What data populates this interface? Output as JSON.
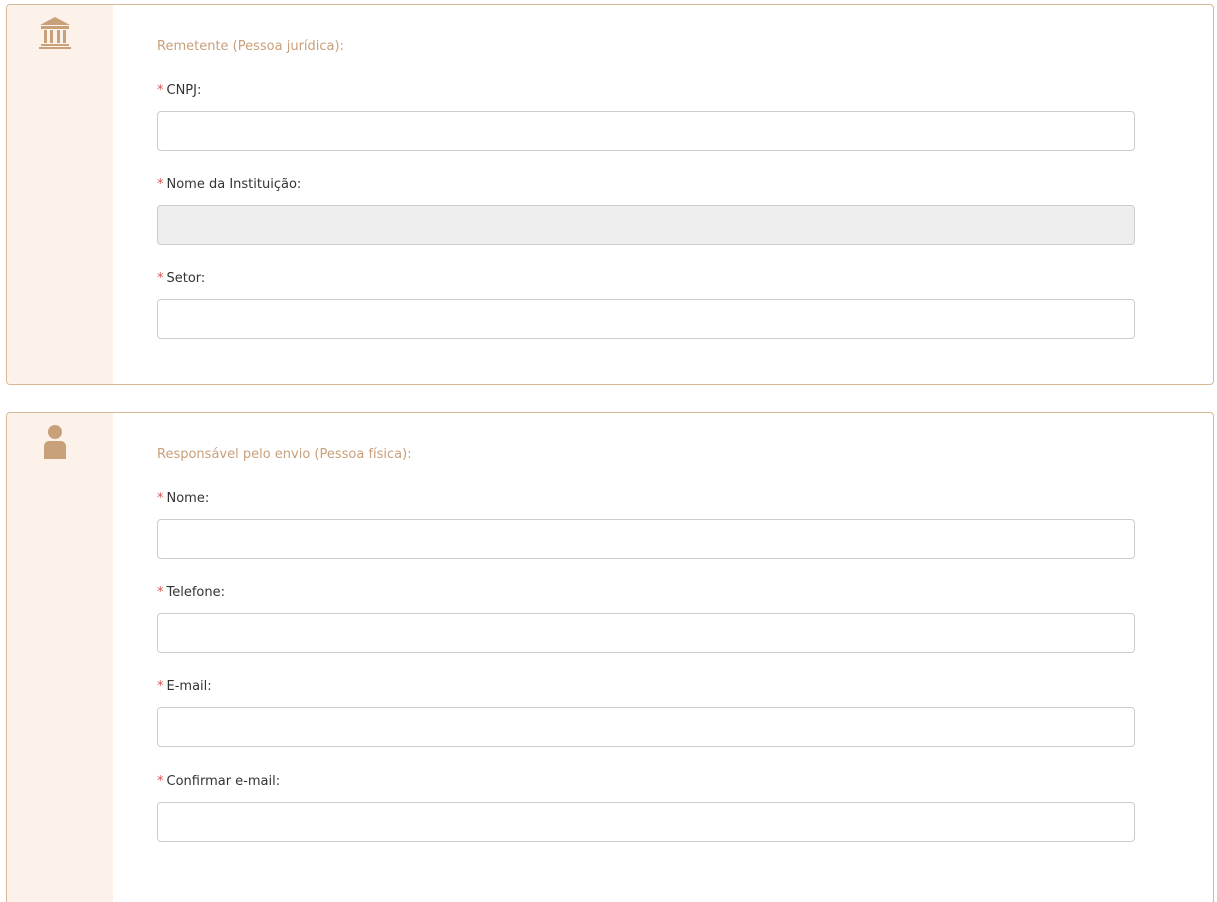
{
  "remetente": {
    "section_title": "Remetente (Pessoa jurídica):",
    "icon": "institution-icon",
    "fields": {
      "cnpj": {
        "required_marker": "*",
        "label": "CNPJ:",
        "value": ""
      },
      "nome_instituicao": {
        "required_marker": "*",
        "label": "Nome da Instituição:",
        "value": ""
      },
      "setor": {
        "required_marker": "*",
        "label": "Setor:",
        "value": ""
      }
    }
  },
  "responsavel": {
    "section_title": "Responsável pelo envio (Pessoa física):",
    "icon": "user-icon",
    "fields": {
      "nome": {
        "required_marker": "*",
        "label": "Nome:",
        "value": ""
      },
      "telefone": {
        "required_marker": "*",
        "label": "Telefone:",
        "value": ""
      },
      "email": {
        "required_marker": "*",
        "label": "E-mail:",
        "value": ""
      },
      "confirmar_email": {
        "required_marker": "*",
        "label": "Confirmar e-mail:",
        "value": ""
      }
    }
  },
  "colors": {
    "panel_border": "#d7b896",
    "sidebar_bg": "#fdf2ea",
    "icon_color": "#c8a07a",
    "section_title": "#c8a07a",
    "required_marker": "#d9534f",
    "disabled_input_bg": "#eeeeee"
  }
}
